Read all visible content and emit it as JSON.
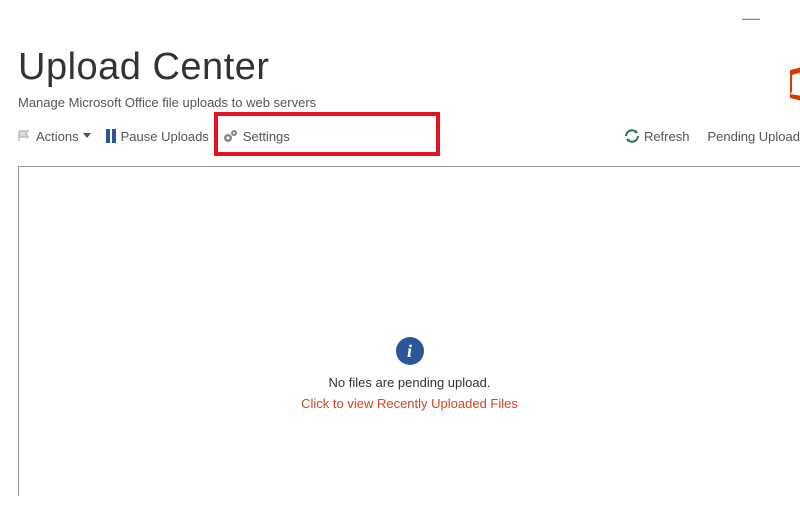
{
  "window": {
    "minimize_symbol": "—"
  },
  "header": {
    "title": "Upload Center",
    "subtitle": "Manage Microsoft Office file uploads to web servers"
  },
  "toolbar": {
    "actions_label": "Actions",
    "pause_label": "Pause Uploads",
    "settings_label": "Settings",
    "refresh_label": "Refresh",
    "pending_label": "Pending Upload"
  },
  "empty_state": {
    "message": "No files are pending upload.",
    "link": "Click to view Recently Uploaded Files"
  },
  "colors": {
    "accent_blue": "#2b579a",
    "link_orange": "#d04521",
    "refresh_green": "#217346",
    "highlight_red": "#e81123",
    "office_orange": "#d83b01"
  }
}
